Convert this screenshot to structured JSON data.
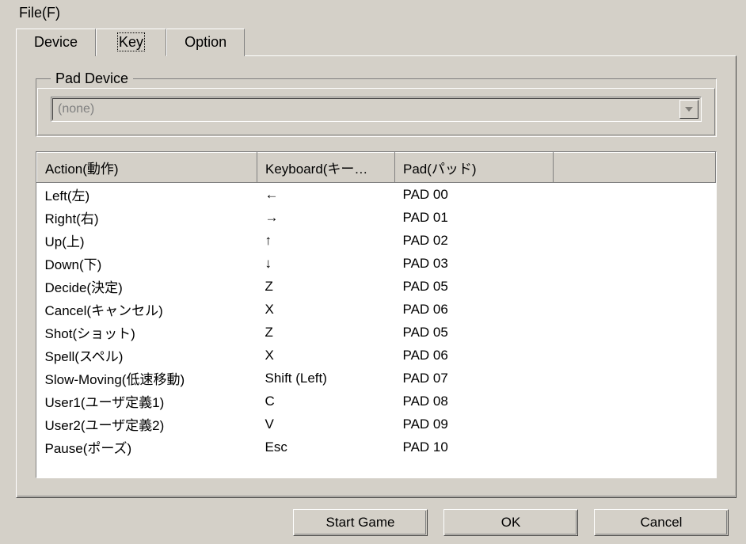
{
  "menu": {
    "file": "File(F)"
  },
  "tabs": {
    "device": "Device",
    "key": "Key",
    "option": "Option",
    "active_index": 1
  },
  "pad_device": {
    "legend": "Pad Device",
    "selected": "(none)"
  },
  "table": {
    "headers": {
      "action": "Action(動作)",
      "keyboard": "Keyboard(キー…",
      "pad": "Pad(パッド)",
      "extra": ""
    },
    "rows": [
      {
        "action": "Left(左)",
        "keyboard": "←",
        "pad": "PAD 00"
      },
      {
        "action": "Right(右)",
        "keyboard": "→",
        "pad": "PAD 01"
      },
      {
        "action": "Up(上)",
        "keyboard": "↑",
        "pad": "PAD 02"
      },
      {
        "action": "Down(下)",
        "keyboard": "↓",
        "pad": "PAD 03"
      },
      {
        "action": "Decide(決定)",
        "keyboard": "Z",
        "pad": "PAD 05"
      },
      {
        "action": "Cancel(キャンセル)",
        "keyboard": "X",
        "pad": "PAD 06"
      },
      {
        "action": "Shot(ショット)",
        "keyboard": "Z",
        "pad": "PAD 05"
      },
      {
        "action": "Spell(スペル)",
        "keyboard": "X",
        "pad": "PAD 06"
      },
      {
        "action": "Slow-Moving(低速移動)",
        "keyboard": "Shift (Left)",
        "pad": "PAD 07"
      },
      {
        "action": "User1(ユーザ定義1)",
        "keyboard": "C",
        "pad": "PAD 08"
      },
      {
        "action": "User2(ユーザ定義2)",
        "keyboard": "V",
        "pad": "PAD 09"
      },
      {
        "action": "Pause(ポーズ)",
        "keyboard": "Esc",
        "pad": "PAD 10"
      },
      {
        "action": "",
        "keyboard": "",
        "pad": ""
      }
    ]
  },
  "buttons": {
    "start": "Start Game",
    "ok": "OK",
    "cancel": "Cancel"
  }
}
